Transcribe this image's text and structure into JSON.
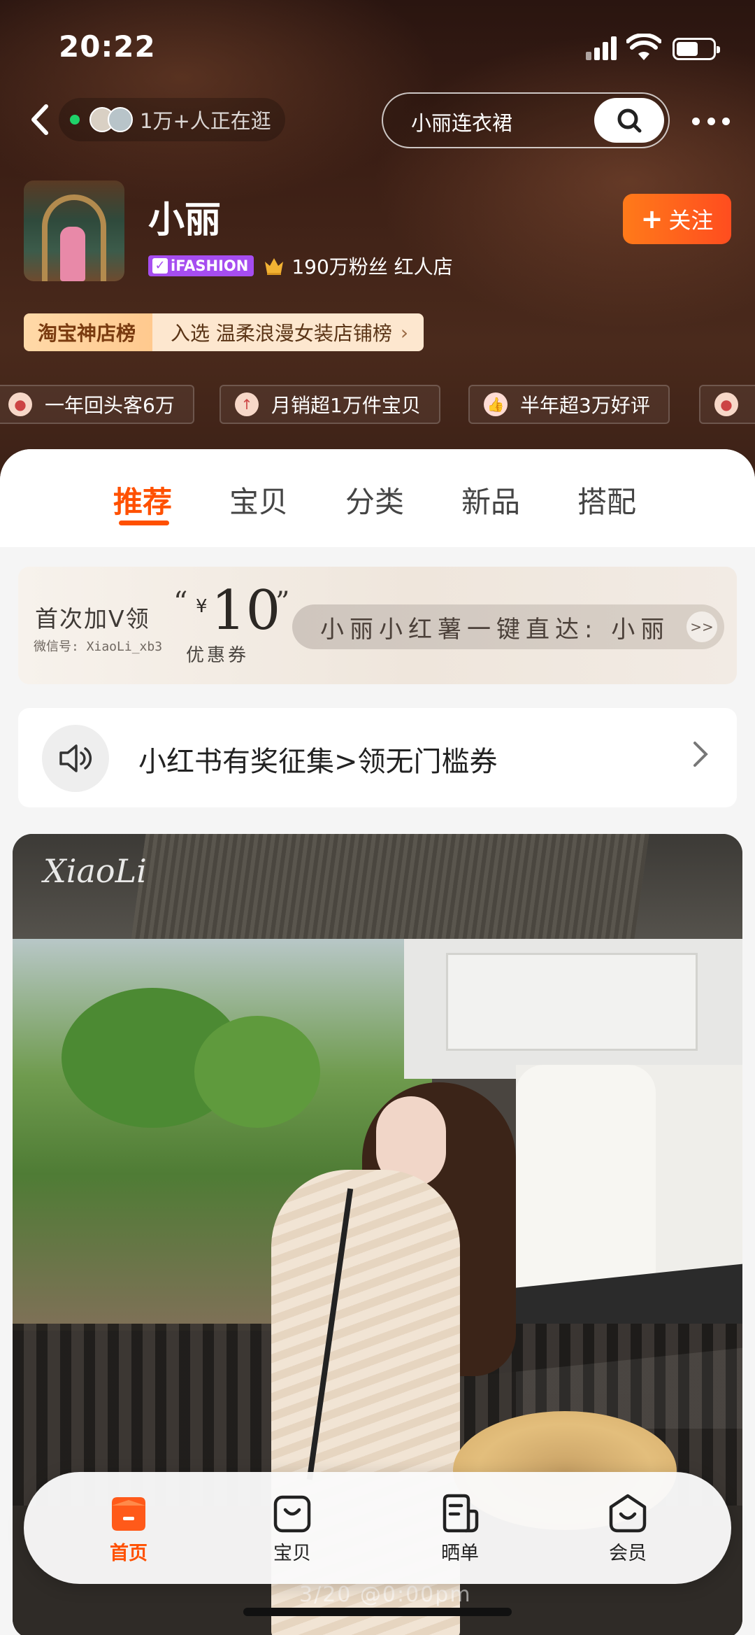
{
  "status_bar": {
    "time": "20:22"
  },
  "header": {
    "viewers_text": "1万+人正在逛",
    "search_query": "小丽连衣裙"
  },
  "shop": {
    "name": "小丽",
    "badge": "iFASHION",
    "fans": "190万粉丝 红人店",
    "follow_label": "关注",
    "rank_label": "淘宝神店榜",
    "rank_text": "入选 温柔浪漫女装店铺榜",
    "tags": [
      "一年回头客6万",
      "月销超1万件宝贝",
      "半年超3万好评"
    ]
  },
  "tabs": [
    {
      "label": "推荐",
      "active": true
    },
    {
      "label": "宝贝",
      "active": false
    },
    {
      "label": "分类",
      "active": false
    },
    {
      "label": "新品",
      "active": false
    },
    {
      "label": "搭配",
      "active": false
    }
  ],
  "coupon": {
    "lead": "首次加V领",
    "wechat": "微信号: XiaoLi_xb3",
    "currency": "¥",
    "amount": "10",
    "open_quote": "“",
    "close_quote": "”",
    "unit": "优惠券",
    "link_text": "小丽小红薯一键直达: 小丽",
    "go": ">>"
  },
  "notice": {
    "text": "小红书有奖征集>领无门槛券"
  },
  "banner": {
    "watermark": "XiaoLi",
    "date": "3/20 @0:00pm"
  },
  "bottom_nav": [
    {
      "label": "首页",
      "icon": "home-bag-icon",
      "active": true
    },
    {
      "label": "宝贝",
      "icon": "bag-icon",
      "active": false
    },
    {
      "label": "晒单",
      "icon": "review-icon",
      "active": false
    },
    {
      "label": "会员",
      "icon": "member-bag-icon",
      "active": false
    }
  ],
  "colors": {
    "accent": "#ff5000",
    "hero_bg": "#3c1f15",
    "badge": "#a64df0"
  }
}
